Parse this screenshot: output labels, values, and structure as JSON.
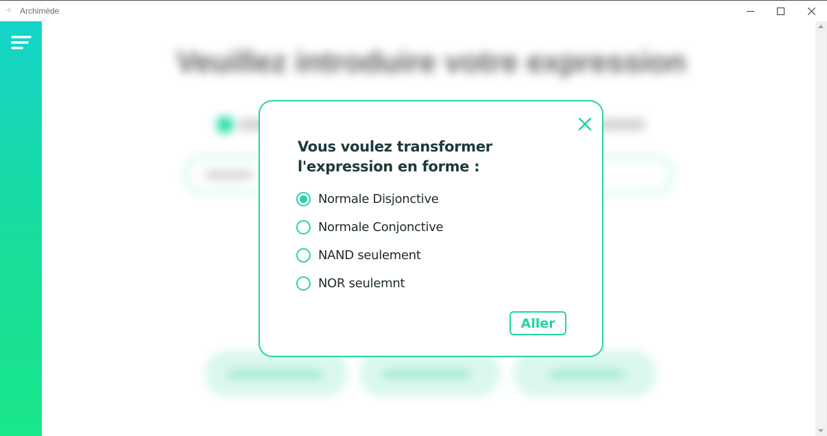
{
  "window": {
    "title": "Archimède",
    "controls": [
      "minimize",
      "maximize",
      "close"
    ]
  },
  "sidebar": {
    "menu_icon": "hamburger-menu-icon"
  },
  "background": {
    "heading": "Veuillez introduire votre expression"
  },
  "dialog": {
    "title": "Vous voulez transformer l'expression en forme :",
    "options": [
      {
        "label": "Normale Disjonctive",
        "selected": true
      },
      {
        "label": "Normale Conjonctive",
        "selected": false
      },
      {
        "label": "NAND seulement",
        "selected": false
      },
      {
        "label": "NOR seulemnt",
        "selected": false
      }
    ],
    "submit_label": "Aller",
    "close_icon": "close-x-icon"
  },
  "colors": {
    "accent": "#22d4a6",
    "sidebar_top": "#15d4c9",
    "sidebar_bottom": "#1ae68a",
    "dialog_title": "#1c3a3a"
  }
}
